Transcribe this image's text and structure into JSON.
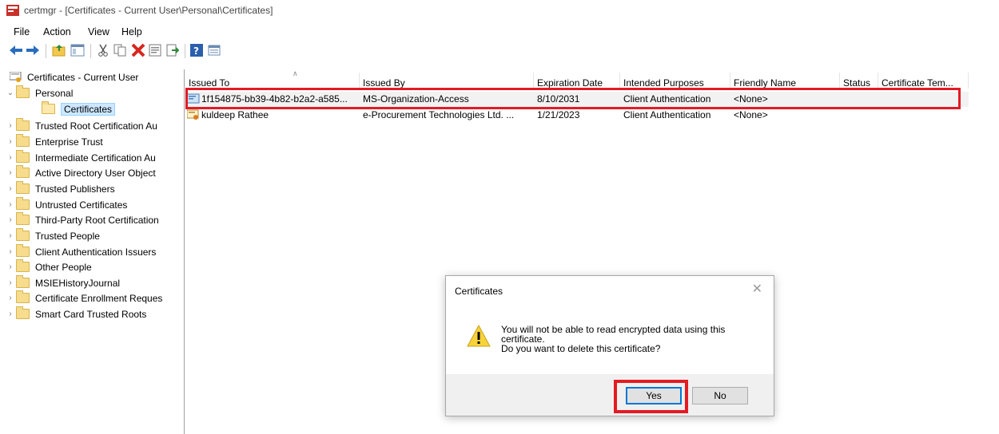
{
  "window": {
    "title": "certmgr - [Certificates - Current User\\Personal\\Certificates]",
    "app_icon": "certmgr-icon"
  },
  "menu": [
    "File",
    "Action",
    "View",
    "Help"
  ],
  "toolbar": {
    "icons": [
      "back-arrow-icon",
      "forward-arrow-icon",
      "up-folder-icon",
      "show-hide-tree-icon",
      "cut-icon",
      "copy-icon",
      "delete-icon",
      "properties-icon",
      "export-list-icon",
      "help-icon",
      "console-tree-icon"
    ]
  },
  "tree": {
    "root": "Certificates - Current User",
    "items": [
      {
        "label": "Personal",
        "expanded": true
      },
      {
        "label": "Certificates",
        "selected": true
      },
      {
        "label": "Trusted Root Certification Au"
      },
      {
        "label": "Enterprise Trust"
      },
      {
        "label": "Intermediate Certification Au"
      },
      {
        "label": "Active Directory User Object"
      },
      {
        "label": "Trusted Publishers"
      },
      {
        "label": "Untrusted Certificates"
      },
      {
        "label": "Third-Party Root Certification"
      },
      {
        "label": "Trusted People"
      },
      {
        "label": "Client Authentication Issuers"
      },
      {
        "label": "Other People"
      },
      {
        "label": "MSIEHistoryJournal"
      },
      {
        "label": "Certificate Enrollment Reques"
      },
      {
        "label": "Smart Card Trusted Roots"
      }
    ]
  },
  "list": {
    "columns": [
      "Issued To",
      "Issued By",
      "Expiration Date",
      "Intended Purposes",
      "Friendly Name",
      "Status",
      "Certificate Tem..."
    ],
    "rows": [
      {
        "issued_to": "1f154875-bb39-4b82-b2a2-a585...",
        "issued_by": "MS-Organization-Access",
        "expiration": "8/10/2031",
        "purposes": "Client Authentication",
        "friendly": "<None>",
        "status": "",
        "template": ""
      },
      {
        "issued_to": "kuldeep Rathee",
        "issued_by": "e-Procurement Technologies Ltd. ...",
        "expiration": "1/21/2023",
        "purposes": "Client Authentication",
        "friendly": "<None>",
        "status": "",
        "template": ""
      }
    ]
  },
  "dialog": {
    "title": "Certificates",
    "message_line1": "You will not be able to read encrypted data using this",
    "message_line2": "certificate.",
    "message_line3": "Do you want to delete this certificate?",
    "yes_label": "Yes",
    "no_label": "No"
  },
  "colors": {
    "highlight": "#e31b23",
    "selection": "#cce8ff",
    "focus_button": "#0078d7"
  }
}
